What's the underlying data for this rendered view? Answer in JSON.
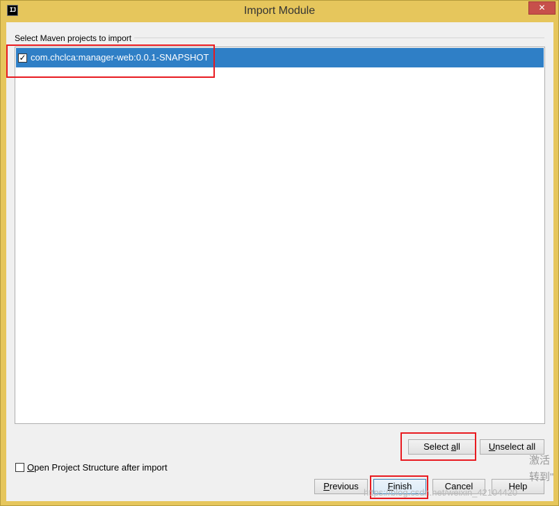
{
  "window": {
    "title": "Import Module",
    "app_icon_text": "IJ",
    "close_glyph": "✕"
  },
  "group": {
    "label": "Select Maven projects to import"
  },
  "projects": [
    {
      "label": "com.chclca:manager-web:0.0.1-SNAPSHOT",
      "checked": true,
      "check_glyph": "✓"
    }
  ],
  "buttons": {
    "select_all_pre": "Select ",
    "select_all_mn": "a",
    "select_all_post": "ll",
    "unselect_all_mn": "U",
    "unselect_all_post": "nselect all",
    "previous_mn": "P",
    "previous_post": "revious",
    "finish_mn": "F",
    "finish_post": "inish",
    "cancel": "Cancel",
    "help": "Help"
  },
  "options": {
    "open_structure_mn": "O",
    "open_structure_post": "pen Project Structure after import",
    "open_structure_checked": false
  },
  "overlay": {
    "watermark_cjk_1": "激活",
    "watermark_cjk_2": "转到\"",
    "watermark_url": "https://blog.csdn.net/weixin_42104420"
  },
  "colors": {
    "titlebar": "#e6c65c",
    "selection": "#2f7fc6",
    "highlight_box": "#e8191f"
  }
}
